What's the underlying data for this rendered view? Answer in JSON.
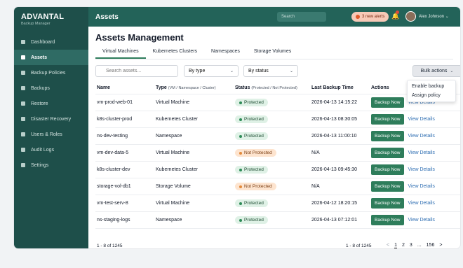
{
  "brand": {
    "title": "ADVANTAL",
    "subtitle": "Backup Manager"
  },
  "sidebar": {
    "items": [
      {
        "label": "Dashboard"
      },
      {
        "label": "Assets"
      },
      {
        "label": "Backup Policies"
      },
      {
        "label": "Backups"
      },
      {
        "label": "Restore"
      },
      {
        "label": "Disaster Recovery"
      },
      {
        "label": "Users & Roles"
      },
      {
        "label": "Audit Logs"
      },
      {
        "label": "Settings"
      }
    ],
    "active_index": 1
  },
  "header": {
    "title": "Assets",
    "search_placeholder": "Search",
    "alerts_label": "3 new alerts",
    "user_name": "Alex Johnson"
  },
  "main": {
    "title": "Assets Management",
    "tabs": [
      {
        "label": "Virtual Machines"
      },
      {
        "label": "Kubernetes Clusters"
      },
      {
        "label": "Namespaces"
      },
      {
        "label": "Storage Volumes"
      }
    ],
    "search_placeholder": "Search assets...",
    "filter_type": "By type",
    "filter_status": "By status",
    "bulk_label": "Bulk actions",
    "bulk_menu": [
      "Enable backup",
      "Assign policy"
    ],
    "columns": {
      "name": "Name",
      "type": "Type",
      "type_sub": "(VM / Namespace / Cluster)",
      "status": "Status",
      "status_sub": "(Protected / Not Protected)",
      "last_backup": "Last Backup Time",
      "actions": "Actions"
    },
    "backup_label": "Backup Now",
    "details_label": "View Details",
    "rows": [
      {
        "name": "vm-prod-web-01",
        "type": "Virtual Machine",
        "status": "Protected",
        "last": "2026-04-13 14:15:22"
      },
      {
        "name": "k8s-cluster-prod",
        "type": "Kubernetes Cluster",
        "status": "Protected",
        "last": "2026-04-13 08:30:05"
      },
      {
        "name": "ns-dev-testing",
        "type": "Namespace",
        "status": "Protected",
        "last": "2026-04-13 11:00:10"
      },
      {
        "name": "vm-dev-data-5",
        "type": "Virtual Machine",
        "status": "Not Protected",
        "last": "N/A"
      },
      {
        "name": "k8s-cluster-dev",
        "type": "Kubernetes Cluster",
        "status": "Protected",
        "last": "2026-04-13 09:45:30"
      },
      {
        "name": "storage-vol-db1",
        "type": "Storage Volume",
        "status": "Not Protected",
        "last": "N/A"
      },
      {
        "name": "vm-test-serv-8",
        "type": "Virtual Machine",
        "status": "Protected",
        "last": "2026-04-12 18:20:15"
      },
      {
        "name": "ns-staging-logs",
        "type": "Namespace",
        "status": "Protected",
        "last": "2026-04-13 07:12:01"
      }
    ],
    "footer_left": "1 - 8 of 1245",
    "footer_range": "1 - 8 of 1245",
    "pages": [
      "<",
      "1",
      "2",
      "3",
      "...",
      "156",
      ">"
    ]
  },
  "colors": {
    "sidebar_bg": "#1e4f4a",
    "header_bg": "#236359",
    "accent": "#2e7d5b",
    "protected": "#2e8b57",
    "not_protected": "#e38a3b",
    "link": "#2f6fb3"
  }
}
